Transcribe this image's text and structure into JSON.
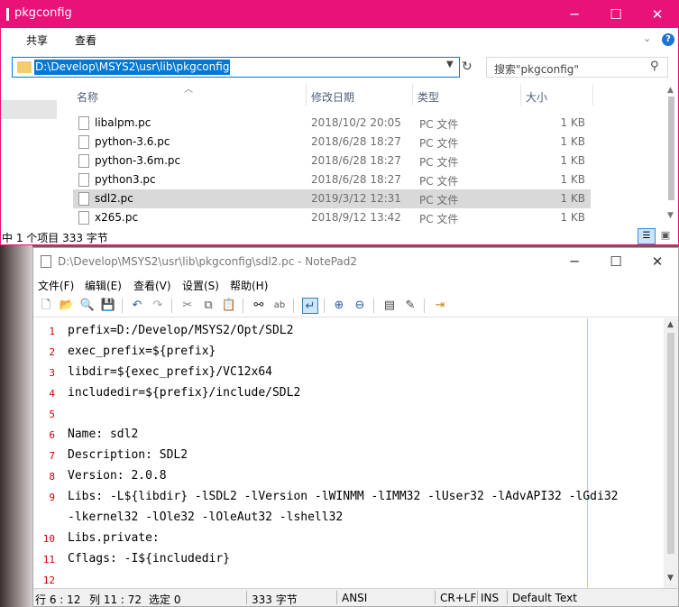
{
  "explorer": {
    "title": "pkgconfig",
    "window_controls": {
      "minimize": "─",
      "maximize": "☐",
      "close": "✕"
    },
    "ribbon_tabs": [
      "共享",
      "查看"
    ],
    "address_path": "D:\\Develop\\MSYS2\\usr\\lib\\pkgconfig",
    "search_placeholder": "搜索\"pkgconfig\"",
    "columns": {
      "name": "名称",
      "date": "修改日期",
      "type": "类型",
      "size": "大小"
    },
    "files": [
      {
        "name": "libalpm.pc",
        "date": "2018/10/2 20:05",
        "type": "PC 文件",
        "size": "1 KB",
        "selected": false
      },
      {
        "name": "python-3.6.pc",
        "date": "2018/6/28 18:27",
        "type": "PC 文件",
        "size": "1 KB",
        "selected": false
      },
      {
        "name": "python-3.6m.pc",
        "date": "2018/6/28 18:27",
        "type": "PC 文件",
        "size": "1 KB",
        "selected": false
      },
      {
        "name": "python3.pc",
        "date": "2018/6/28 18:27",
        "type": "PC 文件",
        "size": "1 KB",
        "selected": false
      },
      {
        "name": "sdl2.pc",
        "date": "2019/3/12 12:31",
        "type": "PC 文件",
        "size": "1 KB",
        "selected": true
      },
      {
        "name": "x265.pc",
        "date": "2018/9/12 13:42",
        "type": "PC 文件",
        "size": "1 KB",
        "selected": false
      }
    ],
    "status": "中 1 个项目  333 字节",
    "accent_color": "#e81279"
  },
  "notepad": {
    "title": "D:\\Develop\\MSYS2\\usr\\lib\\pkgconfig\\sdl2.pc - NotePad2",
    "window_controls": {
      "minimize": "─",
      "maximize": "☐",
      "close": "✕"
    },
    "menu": [
      "文件(F)",
      "编辑(E)",
      "查看(V)",
      "设置(S)",
      "帮助(H)"
    ],
    "toolbar_icons": [
      "new-icon",
      "open-icon",
      "browse-icon",
      "save-icon",
      "undo-icon",
      "redo-icon",
      "cut-icon",
      "copy-icon",
      "paste-icon",
      "find-icon",
      "replace-icon",
      "word-wrap-icon",
      "zoom-in-icon",
      "zoom-out-icon",
      "select-scheme-icon",
      "customize-scheme-icon",
      "exit-icon"
    ],
    "line_numbers": [
      "1",
      "2",
      "3",
      "4",
      "5",
      "6",
      "7",
      "8",
      "9",
      "",
      "10",
      "11",
      "12"
    ],
    "code_lines": [
      "prefix=D:/Develop/MSYS2/Opt/SDL2",
      "exec_prefix=${prefix}",
      "libdir=${exec_prefix}/VC12x64",
      "includedir=${prefix}/include/SDL2",
      "",
      "Name: sdl2",
      "Description: SDL2",
      "Version: 2.0.8",
      "Libs: -L${libdir} -lSDL2 -lVersion -lWINMM -lIMM32 -lUser32 -lAdvAPI32 -lGdi32",
      "-lkernel32 -lOle32 -lOleAut32 -lshell32",
      "Libs.private:",
      "Cflags: -I${includedir}",
      ""
    ],
    "status": {
      "position": "行 6 : 12",
      "column": "列 11 : 72",
      "selection": "选定 0",
      "size": "333 字节",
      "encoding": "ANSI",
      "line_ending": "CR+LF",
      "insert_mode": "INS",
      "scheme": "Default Text"
    }
  }
}
